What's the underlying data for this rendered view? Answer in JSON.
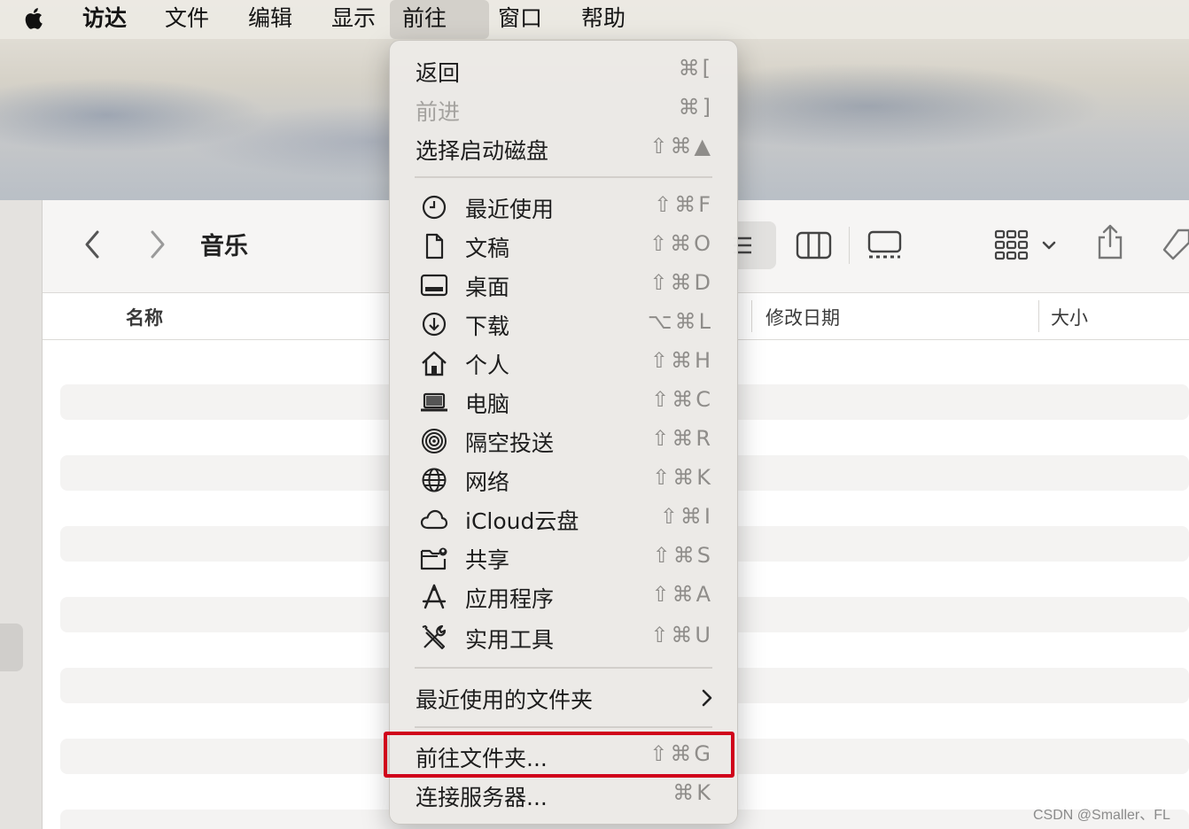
{
  "menubar": {
    "items": [
      {
        "label": "访达"
      },
      {
        "label": "文件"
      },
      {
        "label": "编辑"
      },
      {
        "label": "显示"
      },
      {
        "label": "前往"
      },
      {
        "label": "窗口"
      },
      {
        "label": "帮助"
      }
    ]
  },
  "window": {
    "title": "音乐",
    "columns": {
      "name": "名称",
      "modified": "修改日期",
      "size": "大小"
    }
  },
  "go_menu": {
    "top_items": [
      {
        "label": "返回",
        "shortcut": "⌘[",
        "enabled": true
      },
      {
        "label": "前进",
        "shortcut": "⌘]",
        "enabled": false
      },
      {
        "label": "选择启动磁盘",
        "shortcut": "⇧⌘▲",
        "enabled": true
      }
    ],
    "places": [
      {
        "label": "最近使用",
        "shortcut": "⇧⌘F",
        "icon": "clock-icon"
      },
      {
        "label": "文稿",
        "shortcut": "⇧⌘O",
        "icon": "document-icon"
      },
      {
        "label": "桌面",
        "shortcut": "⇧⌘D",
        "icon": "desktop-icon"
      },
      {
        "label": "下载",
        "shortcut": "⌥⌘L",
        "icon": "download-icon"
      },
      {
        "label": "个人",
        "shortcut": "⇧⌘H",
        "icon": "home-icon"
      },
      {
        "label": "电脑",
        "shortcut": "⇧⌘C",
        "icon": "laptop-icon"
      },
      {
        "label": "隔空投送",
        "shortcut": "⇧⌘R",
        "icon": "airdrop-icon"
      },
      {
        "label": "网络",
        "shortcut": "⇧⌘K",
        "icon": "globe-icon"
      },
      {
        "label": "iCloud云盘",
        "shortcut": "⇧⌘I",
        "icon": "cloud-icon"
      },
      {
        "label": "共享",
        "shortcut": "⇧⌘S",
        "icon": "shared-folder-icon"
      },
      {
        "label": "应用程序",
        "shortcut": "⇧⌘A",
        "icon": "applications-icon"
      },
      {
        "label": "实用工具",
        "shortcut": "⇧⌘U",
        "icon": "utilities-icon"
      }
    ],
    "recent_folders": {
      "label": "最近使用的文件夹"
    },
    "go_to_folder": {
      "label": "前往文件夹...",
      "shortcut": "⇧⌘G"
    },
    "connect_server": {
      "label": "连接服务器...",
      "shortcut": "⌘K"
    }
  },
  "watermark": "CSDN @Smaller、FL",
  "colors": {
    "highlight_border": "#d0021b"
  }
}
